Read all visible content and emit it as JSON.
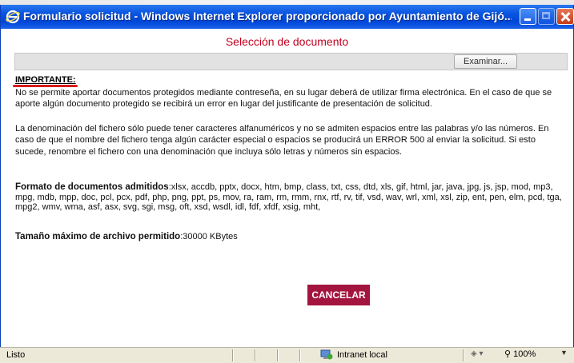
{
  "window": {
    "title": "Formulario solicitud - Windows Internet Explorer proporcionado por Ayuntamiento de Gijó..."
  },
  "page": {
    "title": "Selección de documento",
    "browse_button": "Examinar...",
    "file_value": "",
    "important_heading": "IMPORTANTE:",
    "paragraph1": "No se permite aportar documentos protegidos mediante contreseña, en su lugar deberá de utilizar firma electrónica. En el caso de que se aporte algún documento protegido se recibirá un error en lugar del justificante de presentación de solicitud.",
    "paragraph2": "La denominación del fichero sólo puede tener caracteres alfanuméricos y no se admiten espacios entre las palabras y/o las números. En caso de que el nombre del fichero tenga algún carácter especial o espacios se producirá un ERROR 500 al enviar la solicitud. Si esto sucede, renombre el fichero con una denominación que incluya sólo letras y números sin espacios.",
    "formats_label": "Formato de documentos admitidos",
    "formats_value": ":xlsx, accdb, pptx, docx, htm, bmp, class, txt, css, dtd, xls, gif, html, jar, java, jpg, js, jsp, mod, mp3, mpg, mdb, mpp, doc, pcl, pcx, pdf, php, png, ppt, ps, mov, ra, ram, rm, rmm, rnx, rtf, rv, tif, vsd, wav, wrl, xml, xsl, zip, ent, pen, elm, pcd, tga, mpg2, wmv, wma, asf, asx, svg, sgi, msg, oft, xsd, wsdl, idl, fdf, xfdf, xsig, mht,",
    "max_size_label": "Tamaño máximo de archivo permitido",
    "max_size_value": ":30000 KBytes",
    "cancel_button": "CANCELAR"
  },
  "statusbar": {
    "status": "Listo",
    "zone": "Intranet local",
    "zoom": "100%"
  },
  "colors": {
    "title_red": "#c0001e",
    "cancel_bg": "#a3143f",
    "titlebar_blue": "#0a56e2"
  },
  "icons": [
    "ie-icon",
    "minimize-icon",
    "maximize-icon",
    "close-icon",
    "intranet-zone-icon",
    "protected-mode-icon",
    "zoom-icon"
  ]
}
